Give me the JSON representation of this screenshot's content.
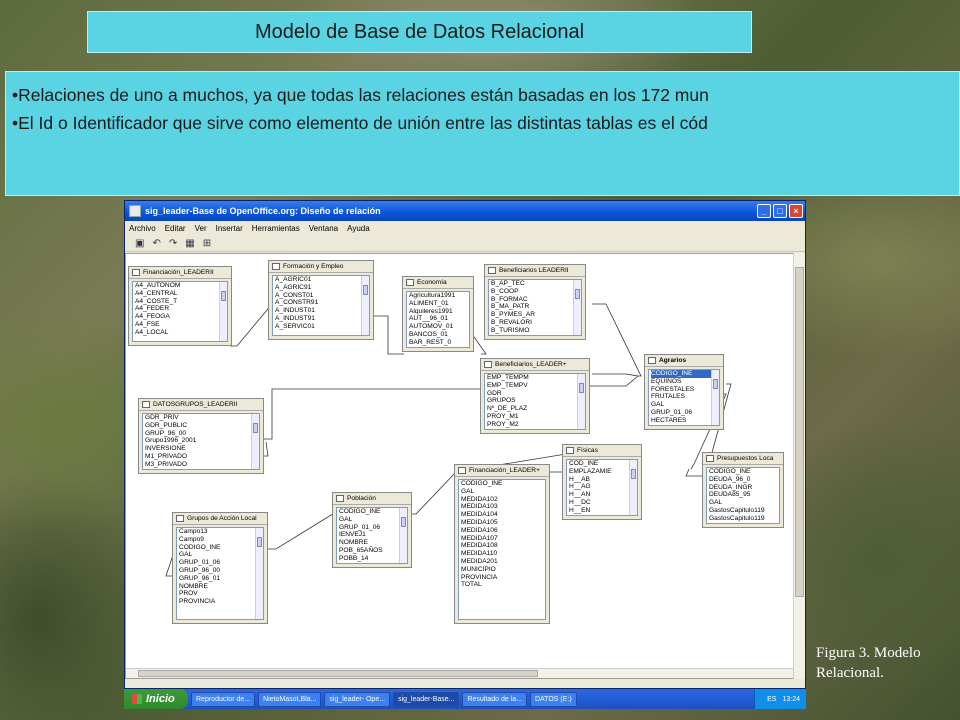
{
  "slide": {
    "title": "Modelo de Base de Datos Relacional",
    "bullets": [
      "•Relaciones de uno a muchos, ya que todas las relaciones están basadas en los 172 mun",
      "•El Id o Identificador que sirve como elemento de unión entre las distintas tablas es el cód"
    ],
    "caption": "Figura 3. Modelo Relacional."
  },
  "window": {
    "title": "sig_leader-Base de OpenOffice.org: Diseño de relación",
    "menu": [
      "Archivo",
      "Editar",
      "Ver",
      "Insertar",
      "Herramientas",
      "Ventana",
      "Ayuda"
    ],
    "toolbar_icons": [
      "save-icon",
      "undo-icon",
      "redo-icon",
      "add-table-icon",
      "new-relation-icon"
    ]
  },
  "tables": [
    {
      "name": "Financiación_LEADERII",
      "fields": [
        "A4_AUTONÓM",
        "A4_CENTRAL",
        "A4_COSTE_T",
        "A4_FEDER",
        "A4_FEOGA",
        "A4_FSE",
        "A4_LOCAL"
      ]
    },
    {
      "name": "Formación y Empleo",
      "fields": [
        "A_AGRIC01",
        "A_AGRIC91",
        "A_CONST01",
        "A_CONSTR91",
        "A_INDUST01",
        "A_INDUST91",
        "A_SERVIC01"
      ]
    },
    {
      "name": "Economía",
      "fields": [
        "Agricultura1991",
        "ALIMENT_01",
        "Alquileres1991",
        "AUT__96_01",
        "AUTOMOV_01",
        "BANCOS_01",
        "BAR_REST_0"
      ]
    },
    {
      "name": "Beneficiarios LEADERII",
      "fields": [
        "B_AP_TEC",
        "B_COOP",
        "B_FORMAC",
        "B_MA_PATR",
        "B_PYMES_AR",
        "B_REVALORI",
        "B_TURISMO"
      ]
    },
    {
      "name": "Beneficiarios_LEADER+",
      "fields": [
        "EMP_TEMPM",
        "EMP_TEMPV",
        "GDR",
        "GRUPOS",
        "Nº_DE_PLAZ",
        "PROY_M1",
        "PROY_M2"
      ]
    },
    {
      "name": "Agrarios",
      "fields": [
        "CODIGO_INE",
        "EQUINOS",
        "FORESTALES",
        "FRUTALES",
        "GAL",
        "GRUP_01_06",
        "HECTARES"
      ]
    },
    {
      "name": "DATOSGRUPOS_LEADERII",
      "fields": [
        "GDR_PRIV",
        "GDR_PUBLIC",
        "GRUP_96_00",
        "Grupo1996_2001",
        "INVERSIONE",
        "M1_PRIVADO",
        "M3_PRIVADO"
      ]
    },
    {
      "name": "Físicas",
      "fields": [
        "COD_INE",
        "EMPLAZAMIE",
        "H__AB",
        "H__AG",
        "H__AN",
        "H__DC",
        "H__EN"
      ]
    },
    {
      "name": "Presupuestos Loca",
      "fields": [
        "CÓDIGO_INE",
        "DEUDA_96_0",
        "DEUDA_INGR",
        "DEUDA85_95",
        "GAL",
        "GastosCapitulo119",
        "GastosCapitulo119"
      ]
    },
    {
      "name": "Financiación_LEADER+",
      "fields": [
        "CODIGO_INE",
        "GAL",
        "MEDIDA102",
        "MEDIDA103",
        "MEDIDA104",
        "MEDIDA105",
        "MEDIDA106",
        "MEDIDA107",
        "MEDIDA108",
        "MEDIDA110",
        "MEDIDA201",
        "MUNICIPIO",
        "PROVINCIA",
        "TOTAL"
      ]
    },
    {
      "name": "Población",
      "fields": [
        "CODIGO_INE",
        "GAL",
        "GRUP_01_06",
        "IENVEJ1",
        "NOMBRE",
        "POB_65AÑOS",
        "POBB_14"
      ]
    },
    {
      "name": "Grupos de Acción Local",
      "fields": [
        "Campo13",
        "Campo9",
        "CODIGO_INE",
        "GAL",
        "GRUP_01_06",
        "GRUP_96_00",
        "GRUP_96_01",
        "NOMBRE",
        "PROV",
        "PROVINCIA"
      ]
    }
  ],
  "taskbar": {
    "start_label": "Inicio",
    "tasks": [
      "Reproductor de...",
      "NietoMasot,Bla...",
      "sig_leader- Ope...",
      "sig_leader-Base...",
      "Resultado de la...",
      "DATOS (E:)"
    ],
    "language": "ES",
    "clock": "13:24"
  }
}
